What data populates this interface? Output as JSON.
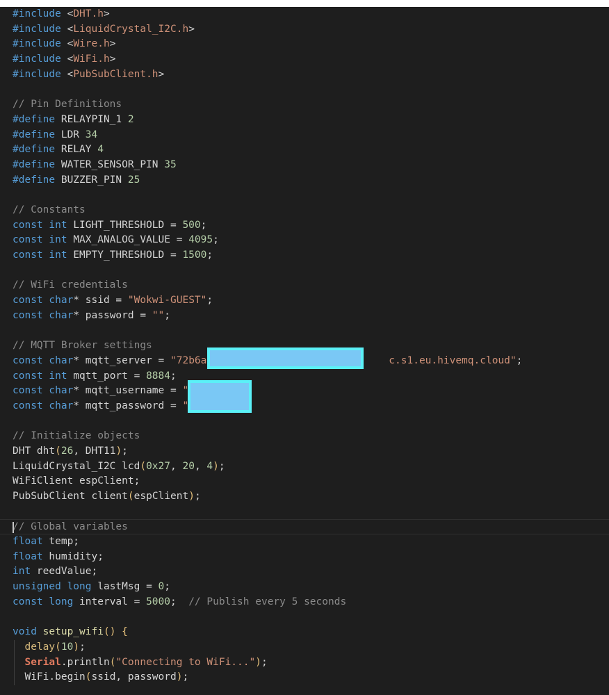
{
  "editor": {
    "theme_colors": {
      "background": "#1e1e1e",
      "keyword": "#569cd6",
      "string": "#ce9178",
      "number": "#b5cea8",
      "comment": "#8a8a8a",
      "redaction_fill": "#7ac8f5",
      "redaction_border": "#5bf0f7"
    },
    "lines": [
      [
        {
          "t": "#include ",
          "c": "def"
        },
        {
          "t": "<",
          "c": "id"
        },
        {
          "t": "DHT.h",
          "c": "inc"
        },
        {
          "t": ">",
          "c": "id"
        }
      ],
      [
        {
          "t": "#include ",
          "c": "def"
        },
        {
          "t": "<",
          "c": "id"
        },
        {
          "t": "LiquidCrystal_I2C.h",
          "c": "inc"
        },
        {
          "t": ">",
          "c": "id"
        }
      ],
      [
        {
          "t": "#include ",
          "c": "def"
        },
        {
          "t": "<",
          "c": "id"
        },
        {
          "t": "Wire.h",
          "c": "inc"
        },
        {
          "t": ">",
          "c": "id"
        }
      ],
      [
        {
          "t": "#include ",
          "c": "def"
        },
        {
          "t": "<",
          "c": "id"
        },
        {
          "t": "WiFi.h",
          "c": "inc"
        },
        {
          "t": ">",
          "c": "id"
        }
      ],
      [
        {
          "t": "#include ",
          "c": "def"
        },
        {
          "t": "<",
          "c": "id"
        },
        {
          "t": "PubSubClient.h",
          "c": "inc"
        },
        {
          "t": ">",
          "c": "id"
        }
      ],
      [],
      [
        {
          "t": "// Pin Definitions",
          "c": "cmt"
        }
      ],
      [
        {
          "t": "#define ",
          "c": "def"
        },
        {
          "t": "RELAYPIN_1 ",
          "c": "id"
        },
        {
          "t": "2",
          "c": "num"
        }
      ],
      [
        {
          "t": "#define ",
          "c": "def"
        },
        {
          "t": "LDR ",
          "c": "id"
        },
        {
          "t": "34",
          "c": "num"
        }
      ],
      [
        {
          "t": "#define ",
          "c": "def"
        },
        {
          "t": "RELAY ",
          "c": "id"
        },
        {
          "t": "4",
          "c": "num"
        }
      ],
      [
        {
          "t": "#define ",
          "c": "def"
        },
        {
          "t": "WATER_SENSOR_PIN ",
          "c": "id"
        },
        {
          "t": "35",
          "c": "num"
        }
      ],
      [
        {
          "t": "#define ",
          "c": "def"
        },
        {
          "t": "BUZZER_PIN ",
          "c": "id"
        },
        {
          "t": "25",
          "c": "num"
        }
      ],
      [],
      [
        {
          "t": "// Constants",
          "c": "cmt"
        }
      ],
      [
        {
          "t": "const ",
          "c": "kw"
        },
        {
          "t": "int ",
          "c": "kw"
        },
        {
          "t": "LIGHT_THRESHOLD = ",
          "c": "id"
        },
        {
          "t": "500",
          "c": "num"
        },
        {
          "t": ";",
          "c": "id"
        }
      ],
      [
        {
          "t": "const ",
          "c": "kw"
        },
        {
          "t": "int ",
          "c": "kw"
        },
        {
          "t": "MAX_ANALOG_VALUE = ",
          "c": "id"
        },
        {
          "t": "4095",
          "c": "num"
        },
        {
          "t": ";",
          "c": "id"
        }
      ],
      [
        {
          "t": "const ",
          "c": "kw"
        },
        {
          "t": "int ",
          "c": "kw"
        },
        {
          "t": "EMPTY_THRESHOLD = ",
          "c": "id"
        },
        {
          "t": "1500",
          "c": "num"
        },
        {
          "t": ";",
          "c": "id"
        }
      ],
      [],
      [
        {
          "t": "// WiFi credentials",
          "c": "cmt"
        }
      ],
      [
        {
          "t": "const ",
          "c": "kw"
        },
        {
          "t": "char",
          "c": "kw"
        },
        {
          "t": "* ssid = ",
          "c": "id"
        },
        {
          "t": "\"Wokwi-GUEST\"",
          "c": "str"
        },
        {
          "t": ";",
          "c": "id"
        }
      ],
      [
        {
          "t": "const ",
          "c": "kw"
        },
        {
          "t": "char",
          "c": "kw"
        },
        {
          "t": "* password = ",
          "c": "id"
        },
        {
          "t": "\"\"",
          "c": "str"
        },
        {
          "t": ";",
          "c": "id"
        }
      ],
      [],
      [
        {
          "t": "// MQTT Broker settings",
          "c": "cmt"
        }
      ],
      [
        {
          "t": "const ",
          "c": "kw"
        },
        {
          "t": "char",
          "c": "kw"
        },
        {
          "t": "* mqtt_server = ",
          "c": "id"
        },
        {
          "t": "\"72b6a",
          "c": "str"
        },
        {
          "t": "                              ",
          "c": "id"
        },
        {
          "t": "c.s1.eu.hivemq.cloud\"",
          "c": "str"
        },
        {
          "t": ";",
          "c": "id"
        }
      ],
      [
        {
          "t": "const ",
          "c": "kw"
        },
        {
          "t": "int ",
          "c": "kw"
        },
        {
          "t": "mqtt_port = ",
          "c": "id"
        },
        {
          "t": "8884",
          "c": "num"
        },
        {
          "t": ";",
          "c": "id"
        }
      ],
      [
        {
          "t": "const ",
          "c": "kw"
        },
        {
          "t": "char",
          "c": "kw"
        },
        {
          "t": "* mqtt_username = ",
          "c": "id"
        },
        {
          "t": "\"",
          "c": "str"
        }
      ],
      [
        {
          "t": "const ",
          "c": "kw"
        },
        {
          "t": "char",
          "c": "kw"
        },
        {
          "t": "* mqtt_password = ",
          "c": "id"
        },
        {
          "t": "\"",
          "c": "str"
        }
      ],
      [],
      [
        {
          "t": "// Initialize objects",
          "c": "cmt"
        }
      ],
      [
        {
          "t": "DHT ",
          "c": "id"
        },
        {
          "t": "dht",
          "c": "id"
        },
        {
          "t": "(",
          "c": "p"
        },
        {
          "t": "26",
          "c": "num"
        },
        {
          "t": ", DHT11",
          "c": "id"
        },
        {
          "t": ")",
          "c": "p"
        },
        {
          "t": ";",
          "c": "id"
        }
      ],
      [
        {
          "t": "LiquidCrystal_I2C ",
          "c": "id"
        },
        {
          "t": "lcd",
          "c": "id"
        },
        {
          "t": "(",
          "c": "p"
        },
        {
          "t": "0x27",
          "c": "num"
        },
        {
          "t": ", ",
          "c": "id"
        },
        {
          "t": "20",
          "c": "num"
        },
        {
          "t": ", ",
          "c": "id"
        },
        {
          "t": "4",
          "c": "num"
        },
        {
          "t": ")",
          "c": "p"
        },
        {
          "t": ";",
          "c": "id"
        }
      ],
      [
        {
          "t": "WiFiClient espClient;",
          "c": "id"
        }
      ],
      [
        {
          "t": "PubSubClient ",
          "c": "id"
        },
        {
          "t": "client",
          "c": "id"
        },
        {
          "t": "(",
          "c": "p"
        },
        {
          "t": "espClient",
          "c": "id"
        },
        {
          "t": ")",
          "c": "p"
        },
        {
          "t": ";",
          "c": "id"
        }
      ],
      [],
      [
        {
          "t": "// Global variables",
          "c": "cmt"
        }
      ],
      [
        {
          "t": "float ",
          "c": "kw"
        },
        {
          "t": "temp;",
          "c": "id"
        }
      ],
      [
        {
          "t": "float ",
          "c": "kw"
        },
        {
          "t": "humidity;",
          "c": "id"
        }
      ],
      [
        {
          "t": "int ",
          "c": "kw"
        },
        {
          "t": "reedValue;",
          "c": "id"
        }
      ],
      [
        {
          "t": "unsigned ",
          "c": "kw"
        },
        {
          "t": "long ",
          "c": "kw"
        },
        {
          "t": "lastMsg = ",
          "c": "id"
        },
        {
          "t": "0",
          "c": "num"
        },
        {
          "t": ";",
          "c": "id"
        }
      ],
      [
        {
          "t": "const ",
          "c": "kw"
        },
        {
          "t": "long ",
          "c": "kw"
        },
        {
          "t": "interval = ",
          "c": "id"
        },
        {
          "t": "5000",
          "c": "num"
        },
        {
          "t": ";  ",
          "c": "id"
        },
        {
          "t": "// Publish every 5 seconds",
          "c": "cmt"
        }
      ],
      [],
      [
        {
          "t": "void ",
          "c": "kw"
        },
        {
          "t": "setup_wifi",
          "c": "fn"
        },
        {
          "t": "() {",
          "c": "p"
        }
      ],
      [
        {
          "t": "  ",
          "c": "id"
        },
        {
          "t": "delay",
          "c": "fnc"
        },
        {
          "t": "(",
          "c": "p"
        },
        {
          "t": "10",
          "c": "num"
        },
        {
          "t": ")",
          "c": "p"
        },
        {
          "t": ";",
          "c": "id"
        }
      ],
      [
        {
          "t": "  ",
          "c": "id"
        },
        {
          "t": "Serial",
          "c": "cls"
        },
        {
          "t": ".",
          "c": "id"
        },
        {
          "t": "println",
          "c": "id"
        },
        {
          "t": "(",
          "c": "p"
        },
        {
          "t": "\"Connecting to WiFi...\"",
          "c": "str"
        },
        {
          "t": ")",
          "c": "p"
        },
        {
          "t": ";",
          "c": "id"
        }
      ],
      [
        {
          "t": "  WiFi.",
          "c": "id"
        },
        {
          "t": "begin",
          "c": "id"
        },
        {
          "t": "(",
          "c": "p"
        },
        {
          "t": "ssid, password",
          "c": "id"
        },
        {
          "t": ")",
          "c": "p"
        },
        {
          "t": ";",
          "c": "id"
        }
      ]
    ],
    "current_line": 34,
    "indent_guide_from": 42
  }
}
